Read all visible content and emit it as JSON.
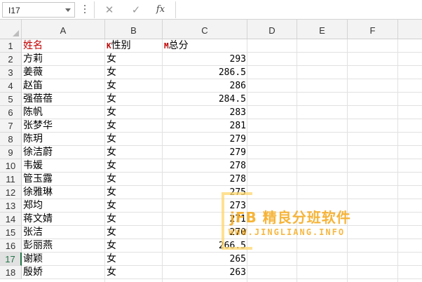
{
  "formula_bar": {
    "name_box": "I17",
    "cancel_icon": "✕",
    "enter_icon": "✓",
    "fx_label": "fx",
    "formula": ""
  },
  "sheet": {
    "columns": [
      "A",
      "B",
      "C",
      "D",
      "E",
      "F"
    ],
    "rows": [
      "1",
      "2",
      "3",
      "4",
      "5",
      "6",
      "7",
      "8",
      "9",
      "10",
      "11",
      "12",
      "13",
      "14",
      "15",
      "16",
      "17",
      "18"
    ],
    "selected_row": "17",
    "header": {
      "name": "姓名",
      "gender_mark": "K",
      "gender": "性别",
      "score_mark": "M",
      "score": "总分"
    },
    "data": [
      {
        "name": "方莉",
        "gender": "女",
        "score": "293"
      },
      {
        "name": "姜薇",
        "gender": "女",
        "score": "286.5"
      },
      {
        "name": "赵笛",
        "gender": "女",
        "score": "286"
      },
      {
        "name": "强蓓蓓",
        "gender": "女",
        "score": "284.5"
      },
      {
        "name": "陈帆",
        "gender": "女",
        "score": "283"
      },
      {
        "name": "张梦华",
        "gender": "女",
        "score": "281"
      },
      {
        "name": "陈玥",
        "gender": "女",
        "score": "279"
      },
      {
        "name": "徐洁蔚",
        "gender": "女",
        "score": "279"
      },
      {
        "name": "韦媛",
        "gender": "女",
        "score": "278"
      },
      {
        "name": "管玉露",
        "gender": "女",
        "score": "278"
      },
      {
        "name": "徐雅琳",
        "gender": "女",
        "score": "275"
      },
      {
        "name": "郑均",
        "gender": "女",
        "score": "273"
      },
      {
        "name": "蒋文婧",
        "gender": "女",
        "score": "271"
      },
      {
        "name": "张洁",
        "gender": "女",
        "score": "270"
      },
      {
        "name": "彭丽燕",
        "gender": "女",
        "score": "266.5"
      },
      {
        "name": "谢颖",
        "gender": "女",
        "score": "265"
      },
      {
        "name": "殷娇",
        "gender": "女",
        "score": "263"
      }
    ]
  },
  "watermark": {
    "title": "jFB 精良分班软件",
    "url": "WWW.JINGLIANG.INFO"
  },
  "colors": {
    "header_text": "#c00000",
    "grid": "#e1e1e1",
    "selection": "#217346",
    "watermark": "#f5ac23"
  }
}
